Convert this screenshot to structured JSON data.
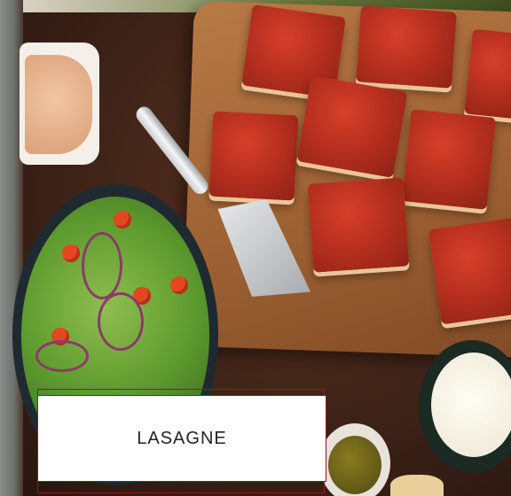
{
  "caption": {
    "title": "LASAGNE"
  },
  "photo": {
    "subject": "lasagne-spread-photo"
  }
}
